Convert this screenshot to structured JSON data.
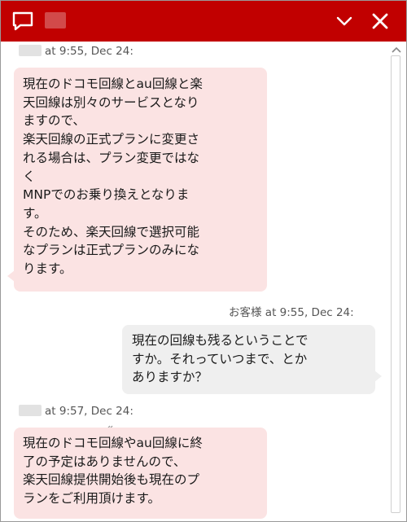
{
  "header": {
    "agent_name_blurred": "",
    "chat_icon": "chat-bubble-icon",
    "minimize_icon": "chevron-down-icon",
    "close_icon": "close-icon",
    "color": "#c10000"
  },
  "messages": [
    {
      "sender": "agent",
      "meta": "at 9:55, Dec 24:",
      "text": "現在のドコモ回線とau回線と楽\n天回線は別々のサービスとなり\nますので、\n楽天回線の正式プランに変更さ\nれる場合は、プラン変更ではな\nく\nMNPでのお乗り換えとなりま\nす。\nそのため、楽天回線で選択可能\nなプランは正式プランのみにな\nります。"
    },
    {
      "sender": "customer",
      "meta": "お客様 at 9:55, Dec 24:",
      "text": "現在の回線も残るということで\nすか。それっていつまで、とか\nありますか？"
    },
    {
      "sender": "agent",
      "meta": "at 9:57, Dec 24:",
      "text": "現在のドコモ回線やau回線に終\n了の予定はありませんので、\n楽天回線提供開始後も現在のプ\nランをご利用頂けます。"
    }
  ],
  "colors": {
    "agent_bubble": "#fbe3e3",
    "customer_bubble": "#efefef"
  }
}
